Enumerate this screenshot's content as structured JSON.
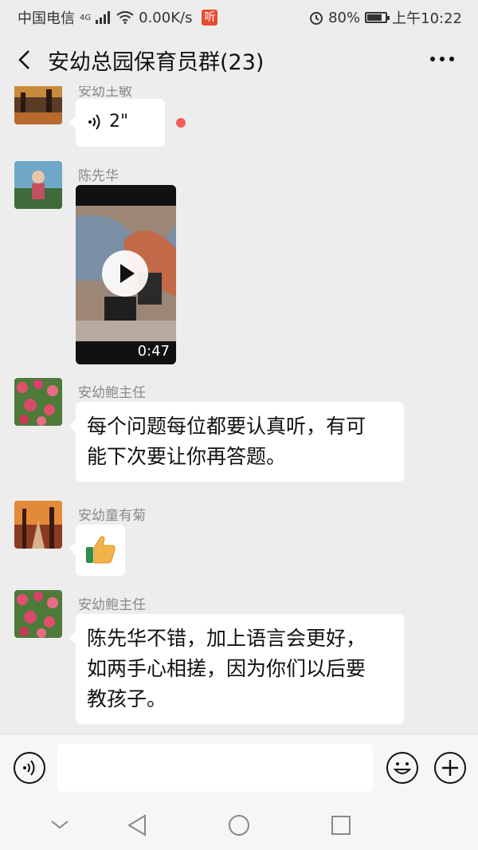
{
  "status_bar": {
    "carrier": "中国电信",
    "network": "4G",
    "speed": "0.00K/s",
    "listen_badge": "听",
    "battery": "80%",
    "battery_level": 0.8,
    "time": "上午10:22"
  },
  "header": {
    "title": "安幼总园保育员群(23)",
    "icons": {
      "back": "back-arrow-icon",
      "more": "more-icon"
    }
  },
  "messages": [
    {
      "sender": "安幼王敏",
      "type": "voice",
      "duration": "2\"",
      "unread": true
    },
    {
      "sender": "陈先华",
      "type": "video",
      "duration": "0:47"
    },
    {
      "sender": "安幼鲍主任",
      "type": "text",
      "lines": [
        "每个问题每位都要认真听，有可",
        "能下次要让你再答题。"
      ]
    },
    {
      "sender": "安幼童有菊",
      "type": "emoji",
      "emoji": "thumbs-up"
    },
    {
      "sender": "安幼鲍主任",
      "type": "text",
      "lines": [
        "陈先华不错，加上语言会更好，",
        "如两手心相搓，因为你们以后要",
        "教孩子。"
      ]
    }
  ],
  "input_bar": {
    "icons": {
      "voice": "voice-input-icon",
      "emoji": "emoji-icon",
      "plus": "plus-icon"
    }
  },
  "nav_bar": {
    "icons": [
      "collapse-icon",
      "back-triangle-icon",
      "home-circle-icon",
      "recents-square-icon"
    ]
  },
  "colors": {
    "background": "#ededed",
    "bubble": "#ffffff",
    "unread_dot": "#f25c5c",
    "badge": "#e64d2e"
  }
}
